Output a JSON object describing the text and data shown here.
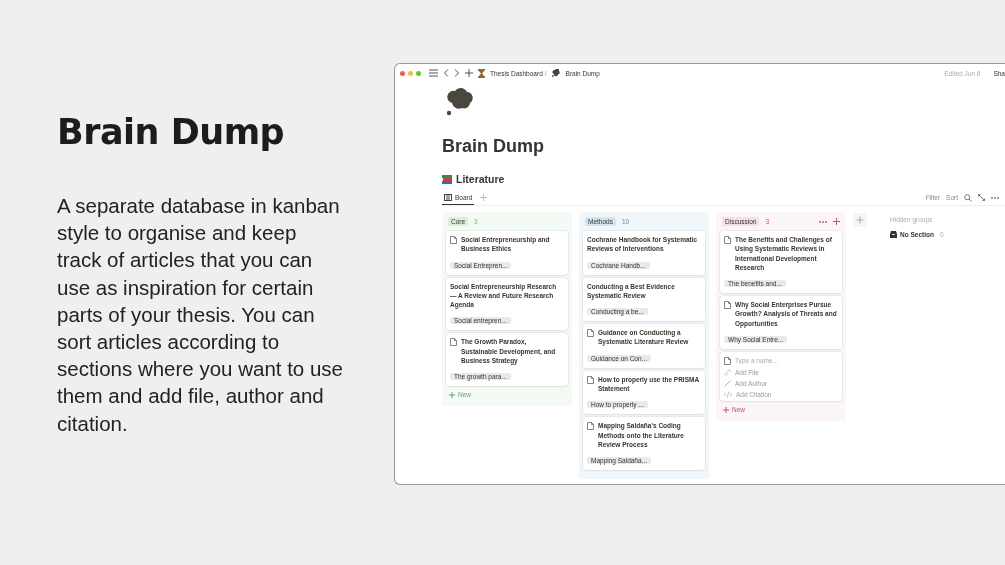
{
  "intro": {
    "title": "Brain Dump",
    "text": "A separate database in kanban style to organise and keep track of articles that you can use as inspiration for certain parts of your thesis. You can sort articles according to sections where you want to use them and add file, author and citation."
  },
  "window": {
    "breadcrumbs": [
      "Thesis Dashboard",
      "Brain Dump"
    ],
    "breadcrumb_separator": "/",
    "edited": "Edited Jun 6",
    "share": "Sha",
    "title": "Brain Dump",
    "database": "Literature",
    "views": [
      {
        "label": "Board",
        "selected": true
      }
    ],
    "toolbar": [
      "Filter",
      "Sort"
    ]
  },
  "columns": [
    {
      "name": "Core",
      "count": "3",
      "color": "#dbeddb",
      "show_actions": false,
      "new_label": "New",
      "cards": [
        {
          "title": "Social Entrepreneurship and Business Ethics",
          "tag": "Social Entrepren...",
          "has_icon": true
        },
        {
          "title": "Social Entrepreneurship Research — A Review and Future Research Agenda",
          "tag": "Social entrepren...",
          "has_icon": false
        },
        {
          "title": "The Growth Paradox, Sustainable Development, and Business Strategy",
          "tag": "The growth para...",
          "has_icon": true
        }
      ]
    },
    {
      "name": "Methods",
      "count": "10",
      "color": "#d3e5ef",
      "show_actions": false,
      "cards": [
        {
          "title": "Cochrane Handbook for Systematic Reviews of Interventions",
          "tag": "Cochrane Handb...",
          "has_icon": false
        },
        {
          "title": "Conducting a Best Evidence Systematic Review",
          "tag": "Conducting a be...",
          "has_icon": false
        },
        {
          "title": "Guidance on Conducting a Systematic Literature Review",
          "tag": "Guidance on Con...",
          "has_icon": true
        },
        {
          "title": "How to properly use the PRISMA Statement",
          "tag": "How to properly ...",
          "has_icon": true
        },
        {
          "title": "Mapping Saldaña's Coding Methods onto the Literature Review Process",
          "tag": "Mapping Saldaña...",
          "has_icon": true
        }
      ]
    },
    {
      "name": "Discussion",
      "count": "3",
      "color": "#f5e0e9",
      "show_actions": true,
      "new_label": "New",
      "cards": [
        {
          "title": "The Benefits and Challenges of Using Systematic Reviews in International Development Research",
          "tag": "The benefits and...",
          "has_icon": true
        },
        {
          "title": "Why Social Enterprises Pursue Growth? Analysis of Threats and Opportunities",
          "tag": "Why Social Entre...",
          "has_icon": true
        }
      ],
      "draft": {
        "placeholder": "Type a name...",
        "fields": [
          {
            "kind": "link",
            "label": "Add File"
          },
          {
            "kind": "pencil",
            "label": "Add Author"
          },
          {
            "kind": "code",
            "label": "Add Citation"
          }
        ]
      }
    }
  ],
  "hidden_groups": {
    "label": "Hidden groups",
    "items": [
      {
        "name": "No Section",
        "count": "0"
      }
    ]
  }
}
